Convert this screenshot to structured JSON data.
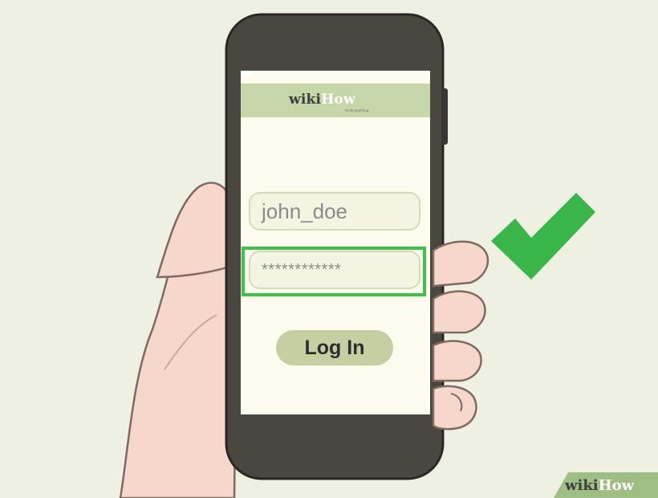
{
  "phone": {
    "app_logo": {
      "part1": "wiki",
      "part2": "How"
    },
    "app_tagline": "to do anything",
    "username_value": "john_doe",
    "password_value": "************",
    "login_label": "Log In"
  },
  "indicators": {
    "field_highlight_color": "#3ec148",
    "checkmark_icon": "checkmark-icon",
    "checkmark_color": "#3ab54a"
  },
  "watermark": {
    "part1": "wiki",
    "part2": "How"
  },
  "colors": {
    "background": "#eef0e2",
    "phone_body": "#4a4640",
    "screen": "#fbfbee",
    "header": "#c5d6a9",
    "button": "#c5cfa2",
    "skin": "#f7d6cb"
  }
}
